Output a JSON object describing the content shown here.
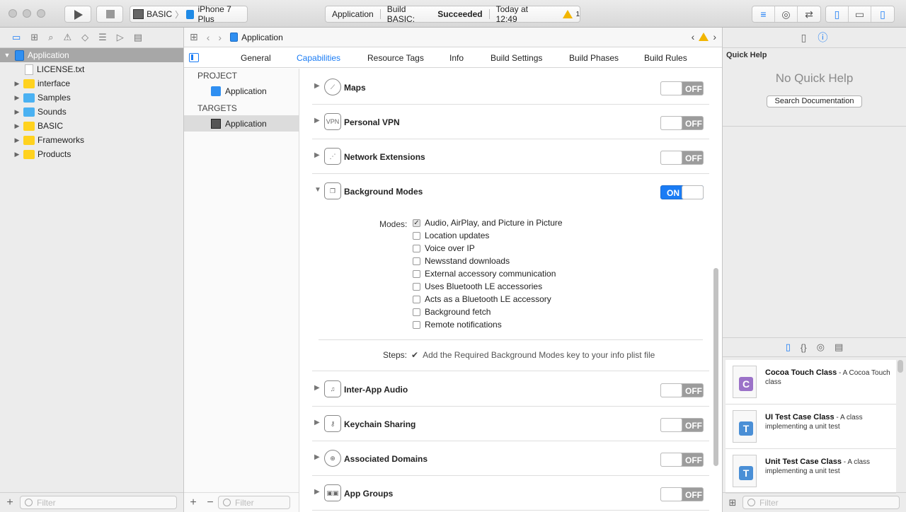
{
  "toolbar": {
    "scheme_name": "BASIC",
    "device_name": "iPhone 7 Plus",
    "status_project": "Application",
    "status_build_prefix": "Build BASIC:",
    "status_build_result": "Succeeded",
    "status_time": "Today at 12:49",
    "warning_count": "1"
  },
  "navigator": {
    "items": [
      {
        "label": "Application",
        "type": "project"
      },
      {
        "label": "LICENSE.txt",
        "type": "file"
      },
      {
        "label": "interface",
        "type": "folder"
      },
      {
        "label": "Samples",
        "type": "folder-blue"
      },
      {
        "label": "Sounds",
        "type": "folder-blue"
      },
      {
        "label": "BASIC",
        "type": "folder"
      },
      {
        "label": "Frameworks",
        "type": "folder"
      },
      {
        "label": "Products",
        "type": "folder"
      }
    ],
    "filter_placeholder": "Filter"
  },
  "editor": {
    "breadcrumb": "Application",
    "tabs": [
      "General",
      "Capabilities",
      "Resource Tags",
      "Info",
      "Build Settings",
      "Build Phases",
      "Build Rules"
    ],
    "project_header": "PROJECT",
    "project_item": "Application",
    "targets_header": "TARGETS",
    "target_item": "Application",
    "filter_placeholder": "Filter"
  },
  "capabilities": [
    {
      "name": "Maps",
      "state": "OFF",
      "icon": "compass-icon"
    },
    {
      "name": "Personal VPN",
      "state": "OFF",
      "icon": "vpn-icon"
    },
    {
      "name": "Network Extensions",
      "state": "OFF",
      "icon": "network-icon"
    },
    {
      "name": "Background Modes",
      "state": "ON",
      "icon": "background-modes-icon"
    },
    {
      "name": "Inter-App Audio",
      "state": "OFF",
      "icon": "audio-icon"
    },
    {
      "name": "Keychain Sharing",
      "state": "OFF",
      "icon": "key-icon"
    },
    {
      "name": "Associated Domains",
      "state": "OFF",
      "icon": "globe-icon"
    },
    {
      "name": "App Groups",
      "state": "OFF",
      "icon": "app-groups-icon"
    }
  ],
  "background_modes": {
    "label": "Modes:",
    "options": [
      {
        "label": "Audio, AirPlay, and Picture in Picture",
        "checked": true
      },
      {
        "label": "Location updates",
        "checked": false
      },
      {
        "label": "Voice over IP",
        "checked": false
      },
      {
        "label": "Newsstand downloads",
        "checked": false
      },
      {
        "label": "External accessory communication",
        "checked": false
      },
      {
        "label": "Uses Bluetooth LE accessories",
        "checked": false
      },
      {
        "label": "Acts as a Bluetooth LE accessory",
        "checked": false
      },
      {
        "label": "Background fetch",
        "checked": false
      },
      {
        "label": "Remote notifications",
        "checked": false
      }
    ],
    "steps_label": "Steps:",
    "steps_text": "Add the Required Background Modes key to your info plist file"
  },
  "inspector": {
    "quick_help_title": "Quick Help",
    "no_quick_help": "No Quick Help",
    "search_button": "Search Documentation",
    "library": [
      {
        "badge": "C",
        "badge_color": "#9b72c8",
        "title": "Cocoa Touch Class",
        "desc": " - A Cocoa Touch class"
      },
      {
        "badge": "T",
        "badge_color": "#4a8fd6",
        "title": "UI Test Case Class",
        "desc": " - A class implementing a unit test"
      },
      {
        "badge": "T",
        "badge_color": "#4a8fd6",
        "title": "Unit Test Case Class",
        "desc": " - A class implementing a unit test"
      }
    ],
    "filter_placeholder": "Filter"
  },
  "colors": {
    "accent": "#1a7cf5",
    "warning": "#f2b500"
  }
}
